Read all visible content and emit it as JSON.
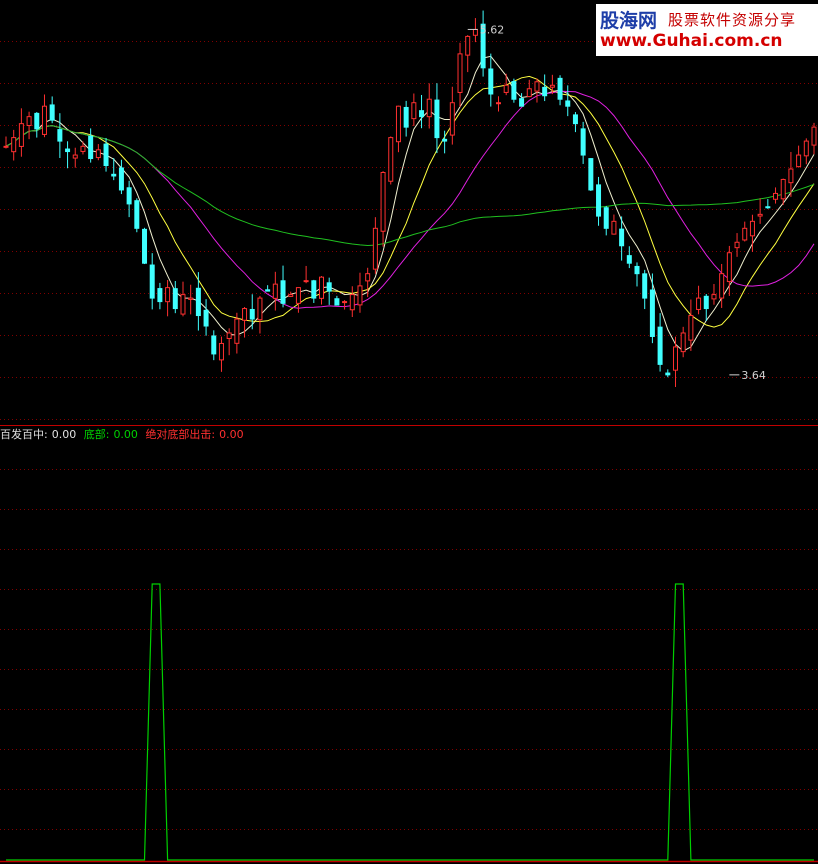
{
  "watermark": {
    "brand": "股海网",
    "slogan": "股票软件资源分享",
    "url": "www.Guhai.com.cn"
  },
  "legend": {
    "item1_label": "百发百中:",
    "item1_value": "0.00",
    "item2_label": "底部:",
    "item2_value": "0.00",
    "item3_label": "绝对底部出击:",
    "item3_value": "0.00",
    "colors": {
      "item1": "#e0e0e0",
      "item2": "#00d000",
      "item3": "#ff3030"
    }
  },
  "chart_data": [
    {
      "type": "candlestick",
      "title": "",
      "price_range": [
        3.45,
        5.72
      ],
      "annotations": [
        {
          "text": "5.62",
          "value": 5.62,
          "bar": 60
        },
        {
          "text": "3.64",
          "value": 3.64,
          "bar": 94
        }
      ],
      "moving_averages": [
        {
          "color": "#f0f0d0",
          "period": 5
        },
        {
          "color": "#ffff40",
          "period": 10
        },
        {
          "color": "#e020e0",
          "period": 20
        },
        {
          "color": "#20c020",
          "period": 60
        }
      ],
      "colors": {
        "up": "#ff3030",
        "down": "#40ffff",
        "grid": "#800000"
      },
      "close": [
        4.95,
        5.0,
        5.08,
        5.12,
        5.05,
        5.18,
        5.1,
        4.98,
        4.92,
        4.9,
        4.95,
        4.88,
        4.93,
        4.84,
        4.78,
        4.7,
        4.62,
        4.48,
        4.28,
        4.08,
        4.06,
        4.14,
        4.02,
        4.1,
        4.08,
        3.98,
        3.92,
        3.76,
        3.82,
        3.88,
        3.96,
        4.02,
        3.96,
        4.08,
        4.12,
        4.16,
        4.05,
        4.1,
        4.14,
        4.18,
        4.08,
        4.2,
        4.12,
        4.04,
        4.06,
        4.1,
        4.15,
        4.22,
        4.48,
        4.8,
        5.0,
        5.18,
        5.06,
        5.2,
        5.12,
        5.22,
        5.0,
        4.98,
        5.2,
        5.48,
        5.58,
        5.62,
        5.4,
        5.25,
        5.2,
        5.3,
        5.22,
        5.18,
        5.28,
        5.32,
        5.24,
        5.3,
        5.22,
        5.18,
        5.08,
        4.9,
        4.7,
        4.55,
        4.48,
        4.52,
        4.38,
        4.28,
        4.22,
        4.08,
        3.86,
        3.7,
        3.64,
        3.8,
        3.88,
        3.98,
        4.08,
        4.02,
        4.1,
        4.22,
        4.34,
        4.4,
        4.48,
        4.52,
        4.56,
        4.6,
        4.68,
        4.76,
        4.82,
        4.9,
        4.98,
        5.06
      ]
    },
    {
      "type": "line",
      "title": "",
      "series": [
        {
          "name": "底部",
          "color": "#00d000",
          "values": [
            0,
            0,
            0,
            0,
            0,
            0,
            0,
            0,
            0,
            0,
            0,
            0,
            0,
            0,
            0,
            0,
            0,
            0,
            0,
            1,
            1,
            0,
            0,
            0,
            0,
            0,
            0,
            0,
            0,
            0,
            0,
            0,
            0,
            0,
            0,
            0,
            0,
            0,
            0,
            0,
            0,
            0,
            0,
            0,
            0,
            0,
            0,
            0,
            0,
            0,
            0,
            0,
            0,
            0,
            0,
            0,
            0,
            0,
            0,
            0,
            0,
            0,
            0,
            0,
            0,
            0,
            0,
            0,
            0,
            0,
            0,
            0,
            0,
            0,
            0,
            0,
            0,
            0,
            0,
            0,
            0,
            0,
            0,
            0,
            0,
            0,
            0,
            1,
            1,
            0,
            0,
            0,
            0,
            0,
            0,
            0,
            0,
            0,
            0,
            0,
            0,
            0,
            0,
            0,
            0,
            0,
            0,
            0,
            0,
            0
          ]
        }
      ],
      "ylim": [
        0,
        1
      ]
    }
  ]
}
